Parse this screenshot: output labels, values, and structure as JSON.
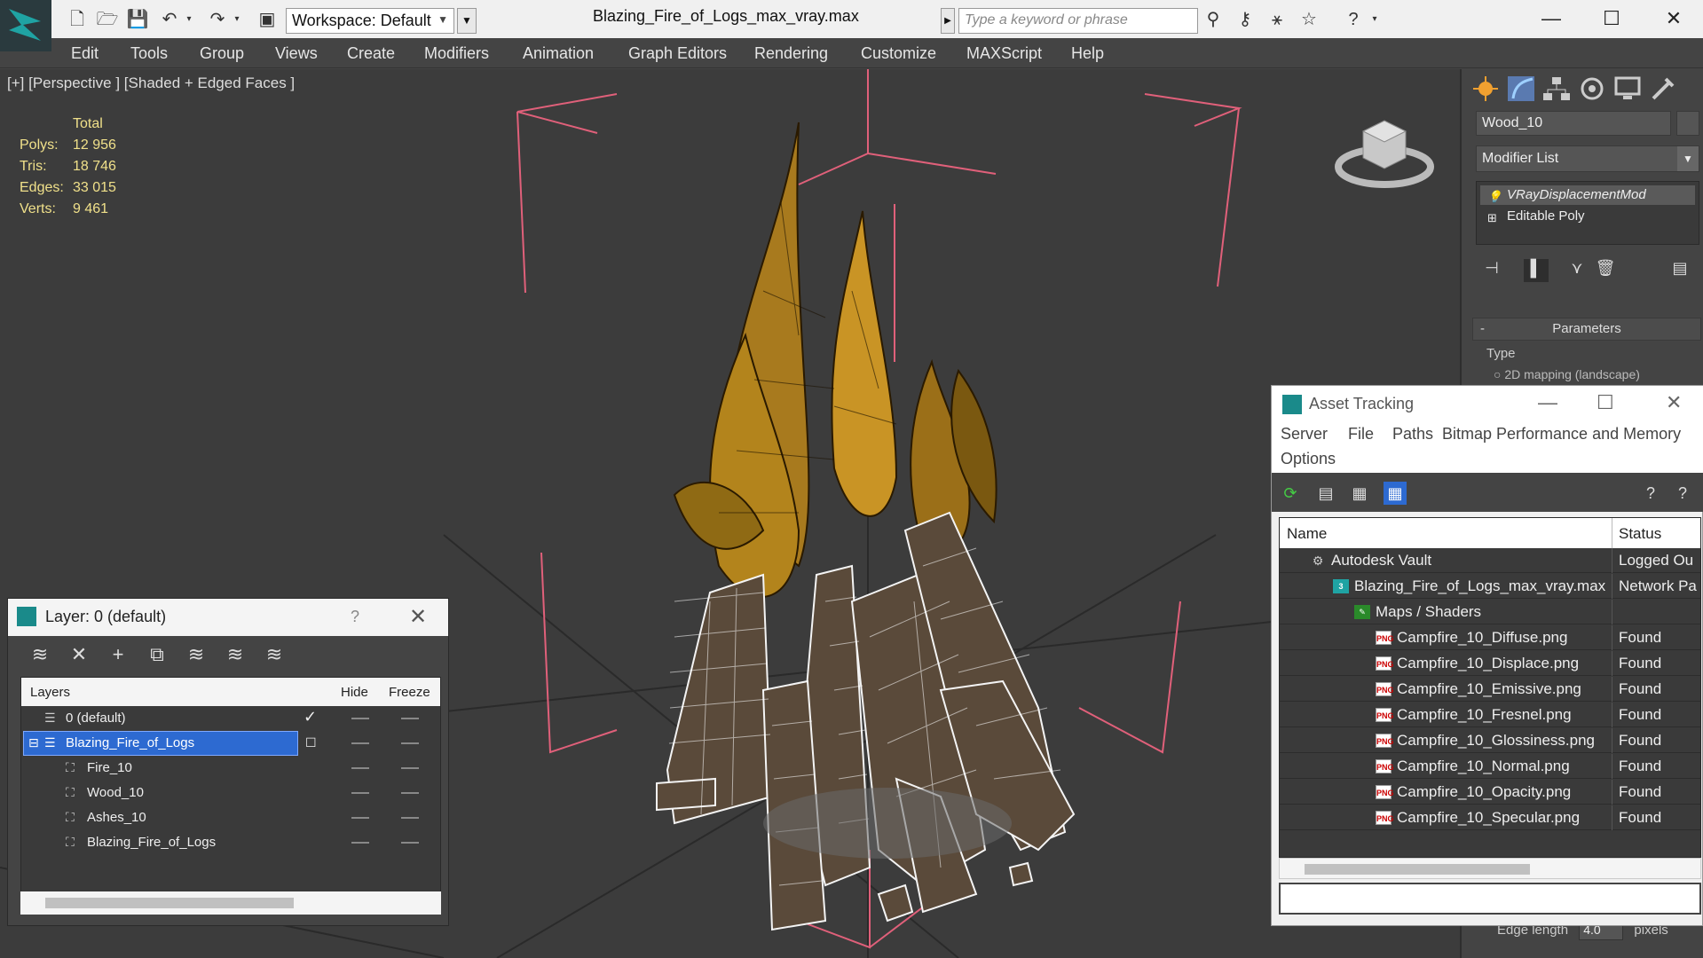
{
  "titlebar": {
    "workspace": "Workspace: Default",
    "file_title": "Blazing_Fire_of_Logs_max_vray.max",
    "search_placeholder": "Type a keyword or phrase"
  },
  "menu": [
    "Edit",
    "Tools",
    "Group",
    "Views",
    "Create",
    "Modifiers",
    "Animation",
    "Graph Editors",
    "Rendering",
    "Customize",
    "MAXScript",
    "Help"
  ],
  "viewport": {
    "label": "[+] [Perspective ] [Shaded + Edged Faces ]",
    "stats": {
      "total_label": "Total",
      "rows": [
        {
          "key": "Polys:",
          "value": "12 956"
        },
        {
          "key": "Tris:",
          "value": "18 746"
        },
        {
          "key": "Edges:",
          "value": "33 015"
        },
        {
          "key": "Verts:",
          "value": "9 461"
        }
      ]
    }
  },
  "command_panel": {
    "object_name": "Wood_10",
    "modifier_list": "Modifier List",
    "stack": [
      "VRayDisplacementMod",
      "Editable Poly"
    ],
    "rollout_title": "Parameters",
    "type_label": "Type",
    "type_option": "2D mapping (landscape)",
    "edge_length_label": "Edge length",
    "edge_length_value": "4.0",
    "edge_length_unit": "pixels"
  },
  "layer_panel": {
    "title": "Layer: 0 (default)",
    "help": "?",
    "columns": {
      "layers": "Layers",
      "hide": "Hide",
      "freeze": "Freeze"
    },
    "rows": [
      {
        "name": "0 (default)",
        "level": 0
      },
      {
        "name": "Blazing_Fire_of_Logs",
        "level": 0
      },
      {
        "name": "Fire_10",
        "level": 1
      },
      {
        "name": "Wood_10",
        "level": 1
      },
      {
        "name": "Ashes_10",
        "level": 1
      },
      {
        "name": "Blazing_Fire_of_Logs",
        "level": 1
      }
    ]
  },
  "asset_panel": {
    "title": "Asset Tracking",
    "menu": [
      "Server",
      "File",
      "Paths",
      "Bitmap Performance and Memory",
      "Options"
    ],
    "columns": {
      "name": "Name",
      "status": "Status"
    },
    "rows": [
      {
        "name": "Autodesk Vault",
        "status": "Logged Ou",
        "icon": "vault-icon"
      },
      {
        "name": "Blazing_Fire_of_Logs_max_vray.max",
        "status": "Network Pa",
        "icon": "max-file-icon"
      },
      {
        "name": "Maps / Shaders",
        "status": "",
        "icon": "maps-icon"
      },
      {
        "name": "Campfire_10_Diffuse.png",
        "status": "Found",
        "icon": "png-icon"
      },
      {
        "name": "Campfire_10_Displace.png",
        "status": "Found",
        "icon": "png-icon"
      },
      {
        "name": "Campfire_10_Emissive.png",
        "status": "Found",
        "icon": "png-icon"
      },
      {
        "name": "Campfire_10_Fresnel.png",
        "status": "Found",
        "icon": "png-icon"
      },
      {
        "name": "Campfire_10_Glossiness.png",
        "status": "Found",
        "icon": "png-icon"
      },
      {
        "name": "Campfire_10_Normal.png",
        "status": "Found",
        "icon": "png-icon"
      },
      {
        "name": "Campfire_10_Opacity.png",
        "status": "Found",
        "icon": "png-icon"
      },
      {
        "name": "Campfire_10_Specular.png",
        "status": "Found",
        "icon": "png-icon"
      }
    ]
  },
  "colors": {
    "viewport_bg": "#3c3c3c",
    "ui_dark": "#444444",
    "stats_text": "#f0e08a",
    "selection_blue": "#2d6ad1",
    "bbox_pink": "#e0607a"
  }
}
